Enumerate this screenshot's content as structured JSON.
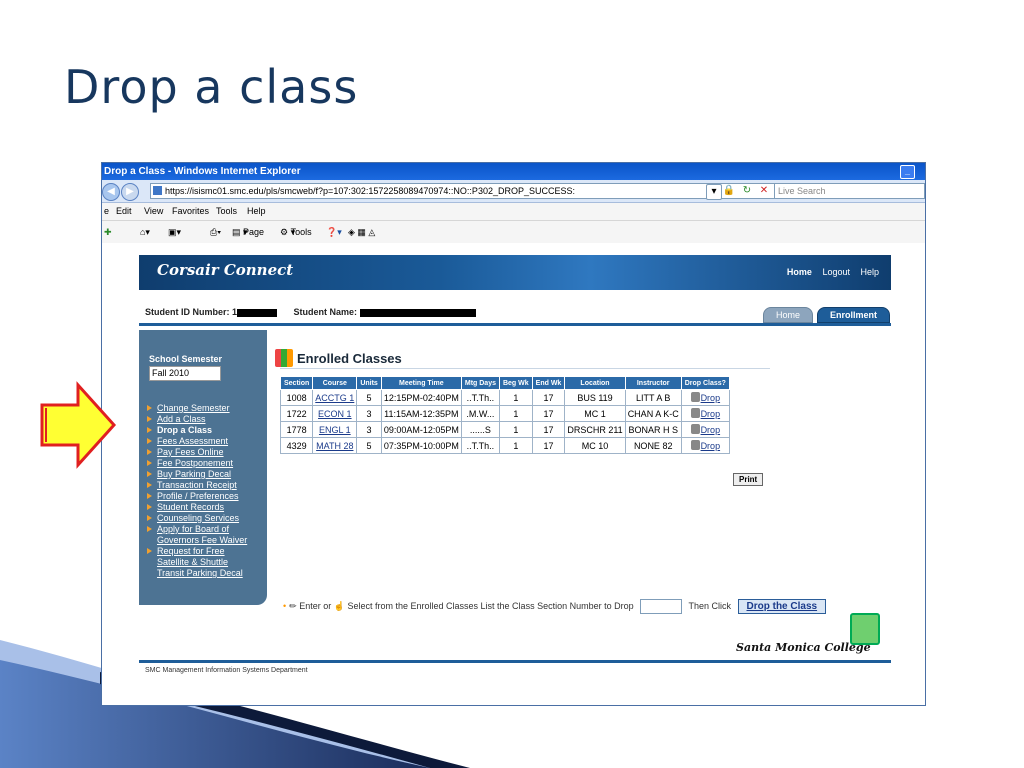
{
  "slide": {
    "title": "Drop a class"
  },
  "browser": {
    "window_title": "Drop a Class - Windows Internet Explorer",
    "url": "https://isismc01.smc.edu/pls/smcweb/f?p=107:302:1572258089470974::NO::P302_DROP_SUCCESS:",
    "search_placeholder": "Live Search",
    "menu": [
      "e",
      "Edit",
      "View",
      "Favorites",
      "Tools",
      "Help"
    ],
    "commands": {
      "page": "Page",
      "tools": "Tools"
    }
  },
  "site": {
    "logo": "Corsair Connect",
    "top_links": [
      "Home",
      "Logout",
      "Help"
    ],
    "student_id_label": "Student ID Number:",
    "student_id_prefix": "1",
    "student_name_label": "Student Name:",
    "tabs": [
      "Home",
      "Enrollment"
    ]
  },
  "sidebar": {
    "semester_label": "School Semester",
    "semester_value": "Fall 2010",
    "links": [
      "Change Semester",
      "Add a Class",
      "Drop a Class",
      "Fees Assessment",
      "Pay Fees Online",
      "Fee Postponement",
      "Buy Parking Decal",
      "Transaction Receipt",
      "Profile / Preferences",
      "Student Records",
      "Counseling Services",
      "Apply for Board of",
      "Governors Fee Waiver",
      "Request for Free",
      "Satellite & Shuttle",
      "Transit Parking Decal"
    ]
  },
  "enrolled": {
    "title": "Enrolled Classes",
    "headers": [
      "Section",
      "Course",
      "Units",
      "Meeting Time",
      "Mtg Days",
      "Beg Wk",
      "End Wk",
      "Location",
      "Instructor",
      "Drop Class?"
    ],
    "rows": [
      [
        "1008",
        "ACCTG 1",
        "5",
        "12:15PM-02:40PM",
        "..T.Th..",
        "1",
        "17",
        "BUS 119",
        "LITT A B",
        "Drop"
      ],
      [
        "1722",
        "ECON 1",
        "3",
        "11:15AM-12:35PM",
        ".M.W...",
        "1",
        "17",
        "MC 1",
        "CHAN A K-C",
        "Drop"
      ],
      [
        "1778",
        "ENGL 1",
        "3",
        "09:00AM-12:05PM",
        "......S",
        "1",
        "17",
        "DRSCHR 211",
        "BONAR H S",
        "Drop"
      ],
      [
        "4329",
        "MATH 28",
        "5",
        "07:35PM-10:00PM",
        "..T.Th..",
        "1",
        "17",
        "MC 10",
        "NONE 82",
        "Drop"
      ]
    ],
    "print_label": "Print"
  },
  "instruction": {
    "enter": "Enter or",
    "select": "Select from the Enrolled Classes List the Class Section Number to Drop",
    "then": "Then Click",
    "button": "Drop the Class"
  },
  "footer": {
    "college": "Santa Monica College",
    "dept": "SMC Management Information Systems Department"
  },
  "colors": {
    "accent": "#1e5d99",
    "sidebar": "#4d7393",
    "arrow_fill": "#ffff33",
    "arrow_stroke": "#e02020"
  }
}
